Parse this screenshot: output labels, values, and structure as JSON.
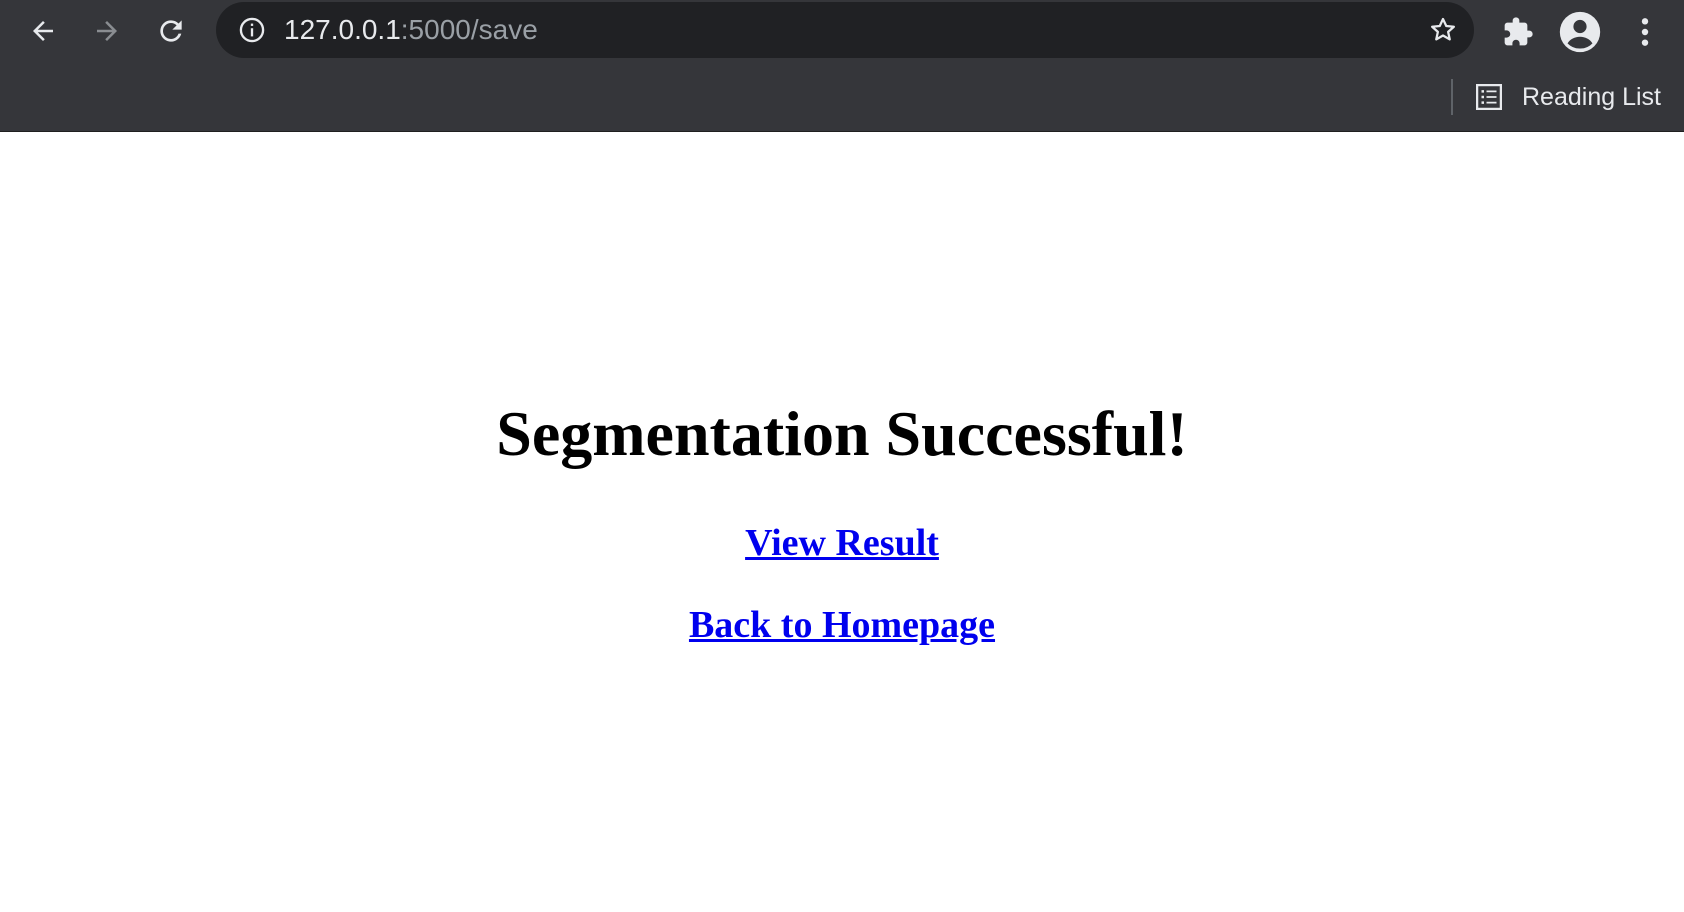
{
  "browser": {
    "url_host": "127.0.0.1",
    "url_path": ":5000/save",
    "bookmarks_bar": {
      "reading_list_label": "Reading List"
    },
    "icons": {
      "back": "back-arrow-icon",
      "forward": "forward-arrow-icon",
      "reload": "reload-icon",
      "site_info": "info-icon",
      "bookmark": "star-icon",
      "extensions": "puzzle-icon",
      "profile": "avatar-icon",
      "menu": "kebab-menu-icon",
      "reading_list": "reading-list-icon"
    },
    "colors": {
      "chrome_bg": "#35363a",
      "omnibox_bg": "#202124",
      "url_host": "#e8eaed",
      "url_path": "#9aa0a6"
    }
  },
  "page": {
    "heading": "Segmentation Successful!",
    "links": [
      {
        "label": "View Result"
      },
      {
        "label": "Back to Homepage"
      }
    ],
    "colors": {
      "link": "#0000ee",
      "heading": "#000000"
    }
  }
}
